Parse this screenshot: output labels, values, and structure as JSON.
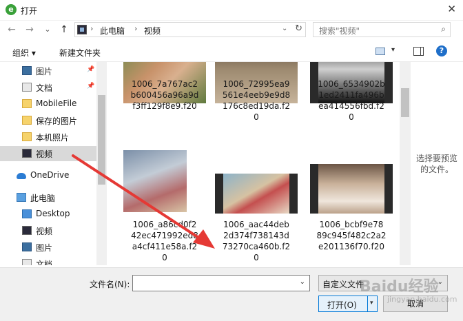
{
  "window": {
    "title": "打开",
    "close_glyph": "✕"
  },
  "nav": {
    "back_glyph": "←",
    "forward_glyph": "→",
    "recent_glyph": "⌄",
    "up_glyph": "↑",
    "address": {
      "separator": "›",
      "segments": [
        "此电脑",
        "视频"
      ],
      "dropdown_glyph": "⌄",
      "refresh_glyph": "↻"
    },
    "search": {
      "placeholder": "搜索\"视频\"",
      "icon_glyph": "⌕"
    }
  },
  "toolbar": {
    "organize_label": "组织 ▾",
    "new_folder_label": "新建文件夹",
    "view_dropdown_glyph": "▾",
    "help_glyph": "?"
  },
  "sidebar": {
    "pin_glyph": "📌",
    "items": [
      {
        "label": "图片",
        "icon": "pictures-icon",
        "pinned": true
      },
      {
        "label": "文档",
        "icon": "document-icon",
        "pinned": true
      },
      {
        "label": "MobileFile",
        "icon": "folder-icon",
        "pinned": false
      },
      {
        "label": "保存的图片",
        "icon": "folder-icon",
        "pinned": false
      },
      {
        "label": "本机照片",
        "icon": "folder-icon",
        "pinned": false
      },
      {
        "label": "视频",
        "icon": "video-icon",
        "pinned": false,
        "selected": true
      },
      {
        "label": "OneDrive",
        "icon": "onedrive-icon",
        "pinned": false
      },
      {
        "label": "此电脑",
        "icon": "computer-icon",
        "pinned": false
      },
      {
        "label": "Desktop",
        "icon": "desktop-icon",
        "pinned": false
      },
      {
        "label": "视频",
        "icon": "video-icon",
        "pinned": false
      },
      {
        "label": "图片",
        "icon": "pictures-icon",
        "pinned": false
      },
      {
        "label": "文档",
        "icon": "document-icon",
        "pinned": false
      }
    ]
  },
  "files": [
    {
      "name": "1006_7a767ac2\nb600456a96a9d\nf3ff129f8e9.f20",
      "kind": "photo"
    },
    {
      "name": "1006_72995ea9\n561e4eeb9e9d8\n176c8ed19da.f2\n0",
      "kind": "photo"
    },
    {
      "name": "1006_6534902b\n1ed2411fa496b\nea414556fbd.f2\n0",
      "kind": "film"
    },
    {
      "name": "1006_a86cd0f2\n42ec471992ed8\na4cf411e58a.f2\n0",
      "kind": "photo"
    },
    {
      "name": "1006_aac44deb\n2d374f738143d\n73270ca460b.f2\n0",
      "kind": "film"
    },
    {
      "name": "1006_bcbf9e78\n89c945f482c2a2\ne201136f70.f20",
      "kind": "film"
    }
  ],
  "preview": {
    "text": "选择要预览的文件。"
  },
  "bottom": {
    "filename_label": "文件名(N):",
    "filename_value": "",
    "filter_value": "自定义文件",
    "dropdown_glyph": "⌄",
    "open_label": "打开(O)",
    "open_dropdown_glyph": "▾",
    "cancel_label": "取消"
  },
  "watermark": {
    "text": "Baidu经验",
    "sub": "jingyan.baidu.com"
  },
  "colors": {
    "accent": "#0078d7",
    "annotation_arrow": "#e53935",
    "selected_bg": "#d9d9d9"
  }
}
